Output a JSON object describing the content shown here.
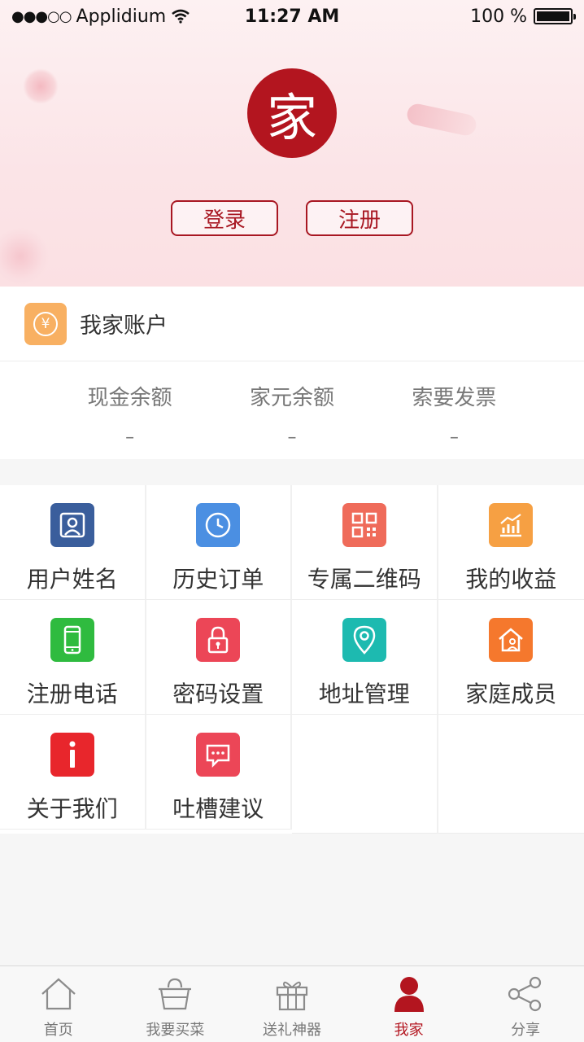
{
  "status_bar": {
    "carrier": "Applidium",
    "signal": "●●●○○",
    "time": "11:27 AM",
    "battery_text": "100 %",
    "battery_level": 1.0
  },
  "header": {
    "logo_char": "家",
    "login_label": "登录",
    "register_label": "注册"
  },
  "account": {
    "title": "我家账户",
    "icon": "yen-icon",
    "icon_char": "¥",
    "icon_color": "#f8b062",
    "balances": [
      {
        "label": "现金余额",
        "value": "–"
      },
      {
        "label": "家元余额",
        "value": "–"
      },
      {
        "label": "索要发票",
        "value": "–"
      }
    ]
  },
  "grid": [
    {
      "label": "用户姓名",
      "icon": "user-icon",
      "color": "#3a5e9c"
    },
    {
      "label": "历史订单",
      "icon": "clock-icon",
      "color": "#4b8fe2"
    },
    {
      "label": "专属二维码",
      "icon": "qrcode-icon",
      "color": "#ef6b5a"
    },
    {
      "label": "我的收益",
      "icon": "earnings-chart-icon",
      "color": "#f6a043"
    },
    {
      "label": "注册电话",
      "icon": "phone-icon",
      "color": "#2fbb3f"
    },
    {
      "label": "密码设置",
      "icon": "lock-icon",
      "color": "#ec4657"
    },
    {
      "label": "地址管理",
      "icon": "location-pin-icon",
      "color": "#1dbab0"
    },
    {
      "label": "家庭成员",
      "icon": "family-home-icon",
      "color": "#f5782d"
    },
    {
      "label": "关于我们",
      "icon": "info-icon",
      "color": "#e8262c"
    },
    {
      "label": "吐槽建议",
      "icon": "feedback-chat-icon",
      "color": "#ec4657"
    }
  ],
  "tabbar": {
    "active_color": "#b3151f",
    "items": [
      {
        "label": "首页",
        "icon": "home-icon",
        "active": false
      },
      {
        "label": "我要买菜",
        "icon": "basket-icon",
        "active": false
      },
      {
        "label": "送礼神器",
        "icon": "gift-icon",
        "active": false
      },
      {
        "label": "我家",
        "icon": "person-icon",
        "active": true
      },
      {
        "label": "分享",
        "icon": "share-icon",
        "active": false
      }
    ]
  }
}
